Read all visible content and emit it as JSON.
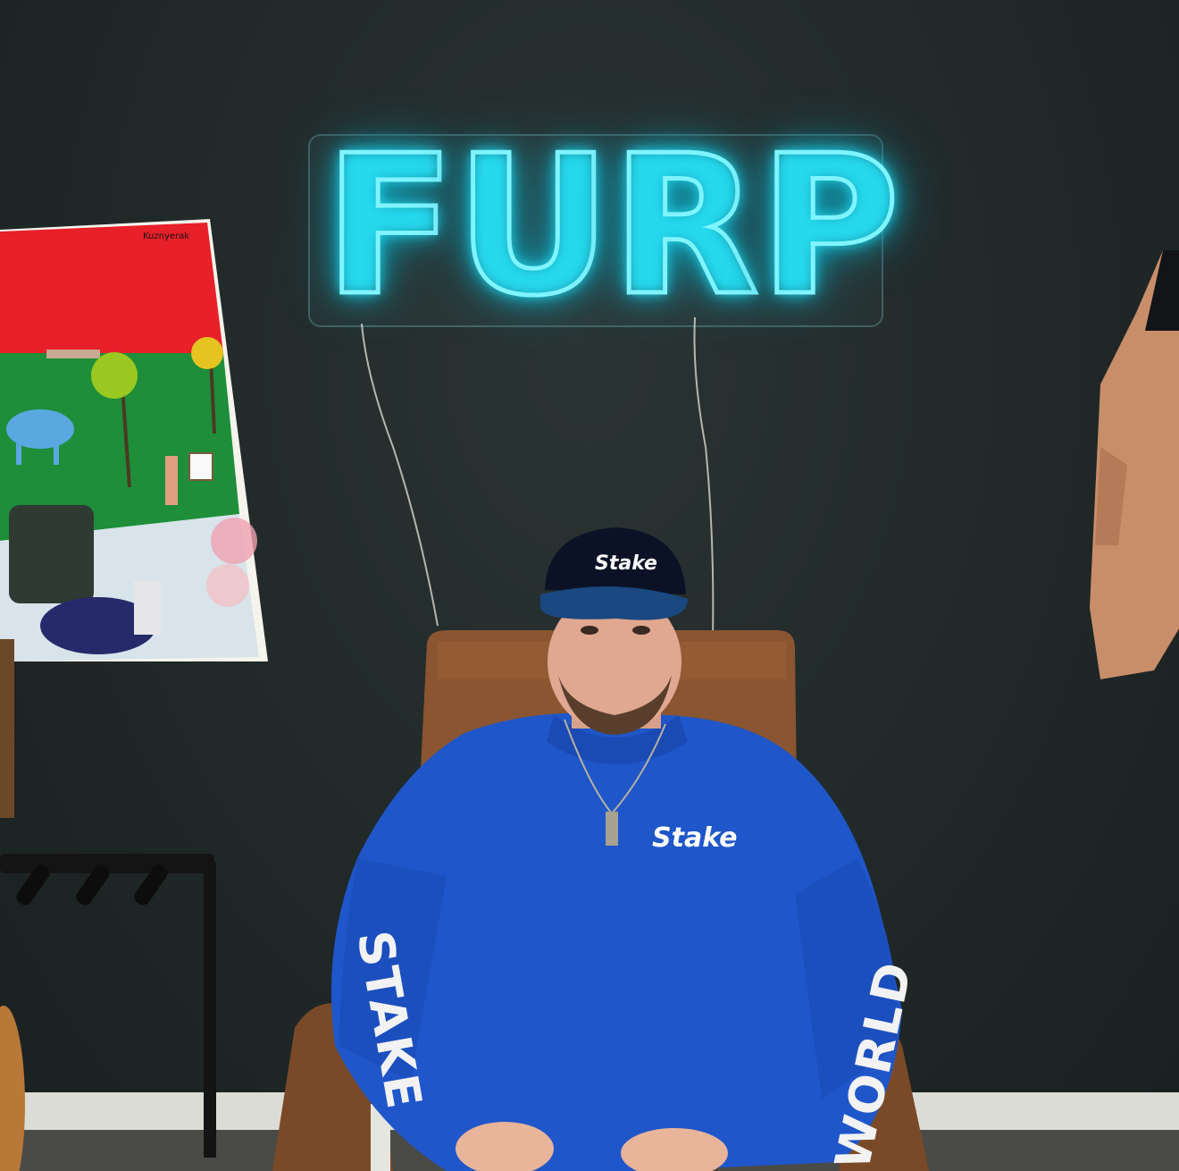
{
  "scene": {
    "description_free": true
  },
  "neon_sign": {
    "text": "FURP",
    "color": "#7ff4ff",
    "glow_color": "#18c4dc"
  },
  "painting": {
    "signature": "Kuznyerak"
  },
  "cap": {
    "logo": "Stake"
  },
  "shirt": {
    "chest_logo": "Stake",
    "left_sleeve_text": "STAKE",
    "right_sleeve_text": "WORLD",
    "color": "#1f56c9"
  },
  "colors": {
    "wall": "#222a2a",
    "painting_sky": "#e8202a",
    "painting_grass": "#1e8e3a",
    "chair": "#8a5530"
  }
}
